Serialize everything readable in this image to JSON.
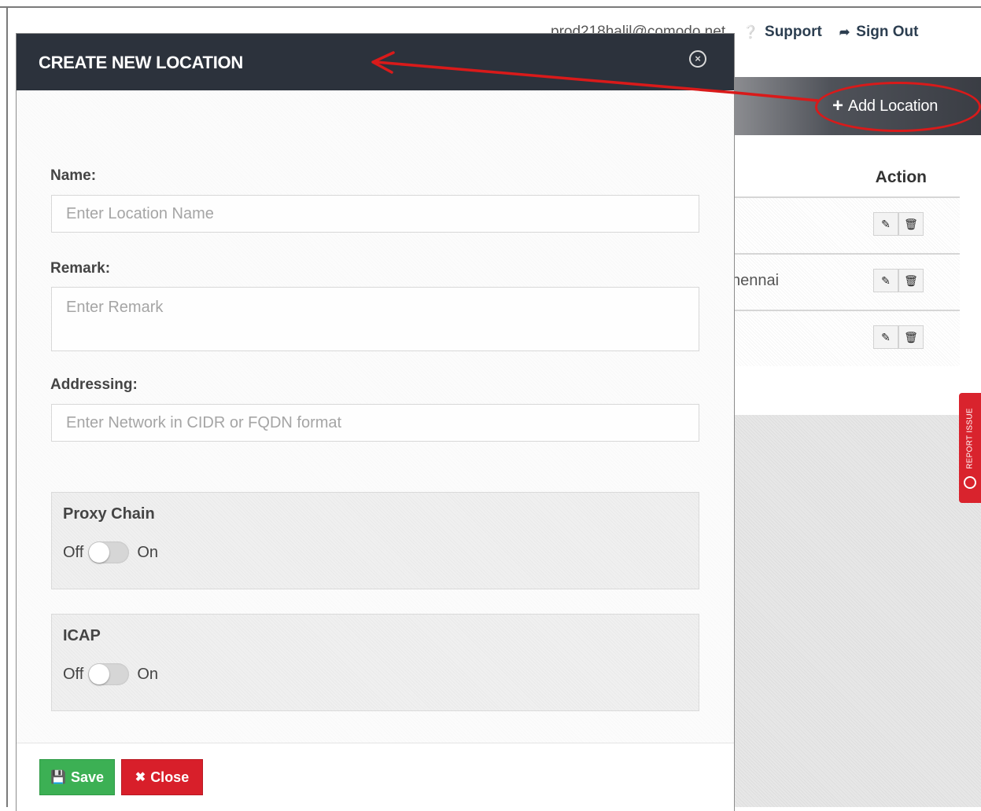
{
  "topbar": {
    "email": "prod218halil@comodo.net",
    "support_label": "Support",
    "signout_label": "Sign Out"
  },
  "toolbar": {
    "add_location_label": "Add Location"
  },
  "table": {
    "action_header": "Action",
    "rows": [
      {
        "text": ""
      },
      {
        "text": "hennai"
      },
      {
        "text": ""
      }
    ]
  },
  "report_issue_label": "REPORT ISSUE",
  "modal": {
    "title": "CREATE NEW LOCATION",
    "name_label": "Name:",
    "name_placeholder": "Enter Location Name",
    "remark_label": "Remark:",
    "remark_placeholder": "Enter Remark",
    "addressing_label": "Addressing:",
    "addressing_placeholder": "Enter Network in CIDR or FQDN format",
    "proxy_chain": {
      "title": "Proxy Chain",
      "off": "Off",
      "on": "On",
      "enabled": false
    },
    "icap": {
      "title": "ICAP",
      "off": "Off",
      "on": "On",
      "enabled": false
    },
    "save_label": "Save",
    "close_label": "Close"
  },
  "colors": {
    "modal_header": "#2c323c",
    "save_green": "#3cb054",
    "close_red": "#d81f2a",
    "annotation_red": "#d91a1a"
  }
}
